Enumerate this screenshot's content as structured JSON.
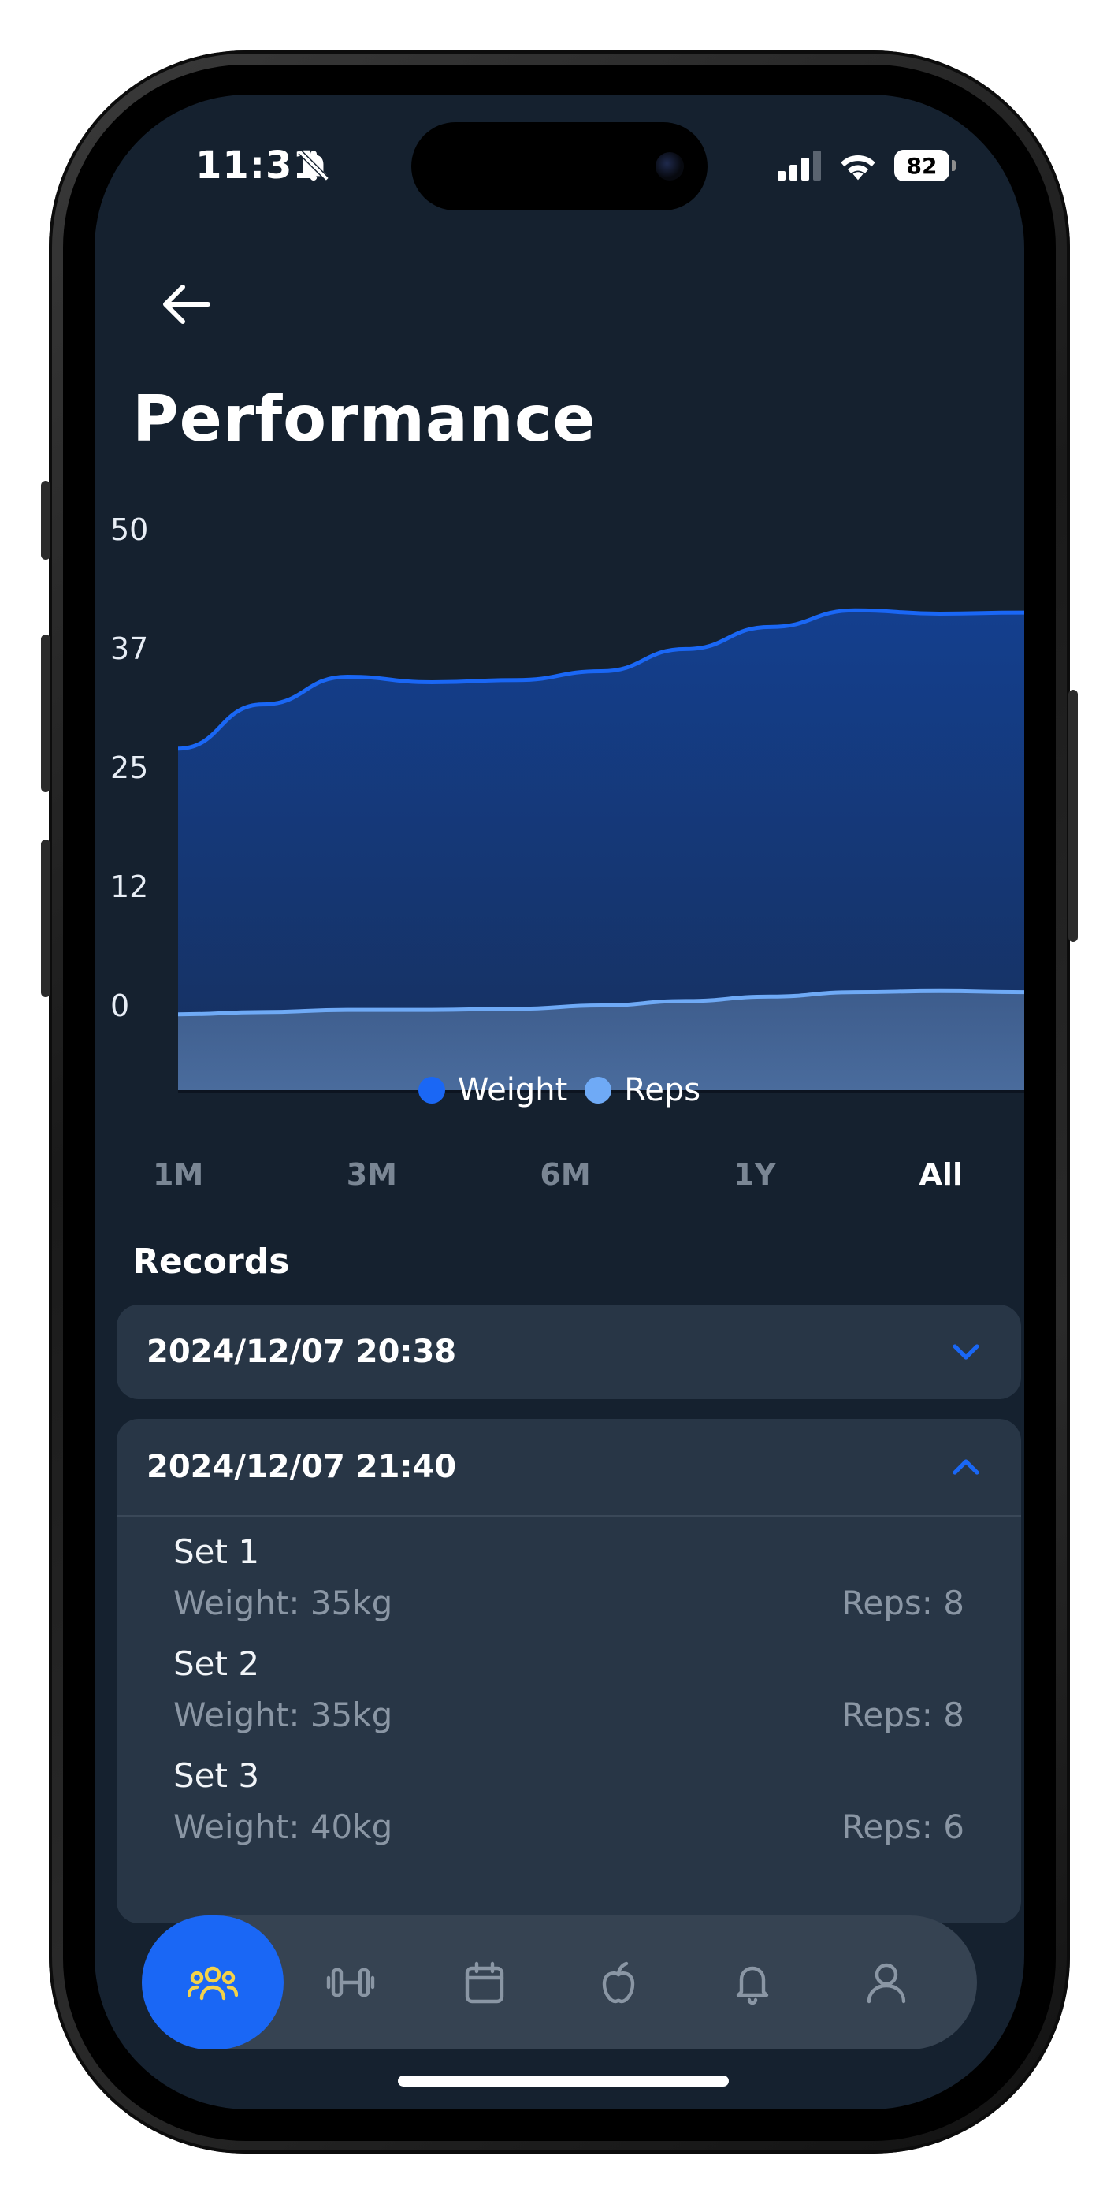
{
  "status_bar": {
    "time": "11:31",
    "battery": "82"
  },
  "header": {
    "title": "Performance"
  },
  "chart_data": {
    "type": "area",
    "x": [
      0,
      1,
      2,
      3,
      4,
      5,
      6,
      7,
      8,
      9,
      10
    ],
    "ylim": [
      0,
      50
    ],
    "y_ticks": [
      "50",
      "37",
      "25",
      "12",
      "0"
    ],
    "series": [
      {
        "name": "Weight",
        "values": [
          31,
          35,
          37.5,
          37,
          37.2,
          38,
          40,
          42,
          43.5,
          43.2,
          43.3
        ]
      },
      {
        "name": "Reps",
        "values": [
          7,
          7.2,
          7.4,
          7.4,
          7.5,
          7.8,
          8.2,
          8.6,
          9,
          9.1,
          9
        ]
      }
    ],
    "colors": {
      "Weight": "#1a67f5",
      "Reps": "#6faaf6"
    }
  },
  "legend": [
    {
      "label": "Weight",
      "color": "#1a67f5"
    },
    {
      "label": "Reps",
      "color": "#6faaf6"
    }
  ],
  "ranges": [
    {
      "label": "1M"
    },
    {
      "label": "3M"
    },
    {
      "label": "6M"
    },
    {
      "label": "1Y"
    },
    {
      "label": "All"
    }
  ],
  "records": {
    "title": "Records",
    "collapsed_date": "2024/12/07 20:38",
    "open_date": "2024/12/07 21:40",
    "sets": [
      {
        "title": "Set 1",
        "weight": "Weight: 35kg",
        "reps": "Reps: 8"
      },
      {
        "title": "Set 2",
        "weight": "Weight: 35kg",
        "reps": "Reps: 8"
      },
      {
        "title": "Set 3",
        "weight": "Weight: 40kg",
        "reps": "Reps: 6"
      }
    ]
  },
  "tabbar": [
    {
      "icon": "community-icon"
    },
    {
      "icon": "dumbbell-icon"
    },
    {
      "icon": "calendar-icon"
    },
    {
      "icon": "apple-icon"
    },
    {
      "icon": "bell-icon"
    },
    {
      "icon": "profile-icon"
    }
  ],
  "accent": "#1a67f5"
}
